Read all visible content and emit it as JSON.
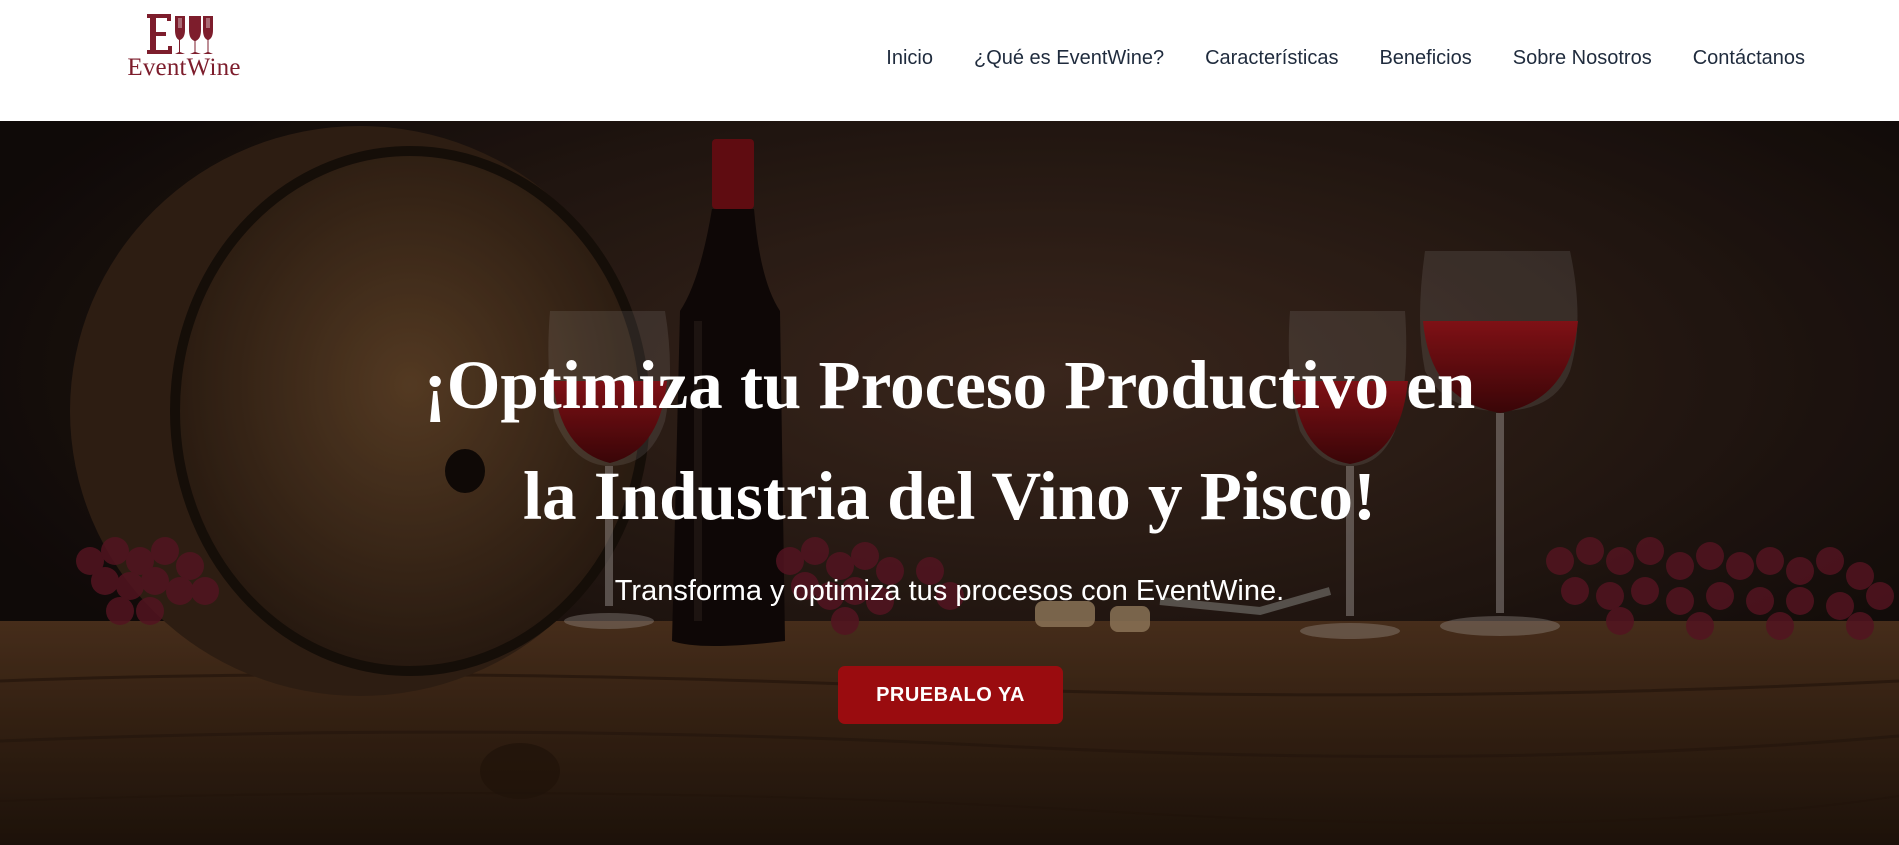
{
  "brand": {
    "name": "EventWine",
    "accent_color": "#7d1d2c"
  },
  "nav": {
    "items": [
      {
        "label": "Inicio"
      },
      {
        "label": "¿Qué es EventWine?"
      },
      {
        "label": "Características"
      },
      {
        "label": "Beneficios"
      },
      {
        "label": "Sobre Nosotros"
      },
      {
        "label": "Contáctanos"
      }
    ]
  },
  "hero": {
    "title_line1": "¡Optimiza tu Proceso Productivo en",
    "title_line2": "la Industria del Vino y Pisco!",
    "subtitle": "Transforma y optimiza tus procesos con EventWine.",
    "cta_label": "PRUEBALO YA",
    "cta_color": "#9a0c0f"
  }
}
